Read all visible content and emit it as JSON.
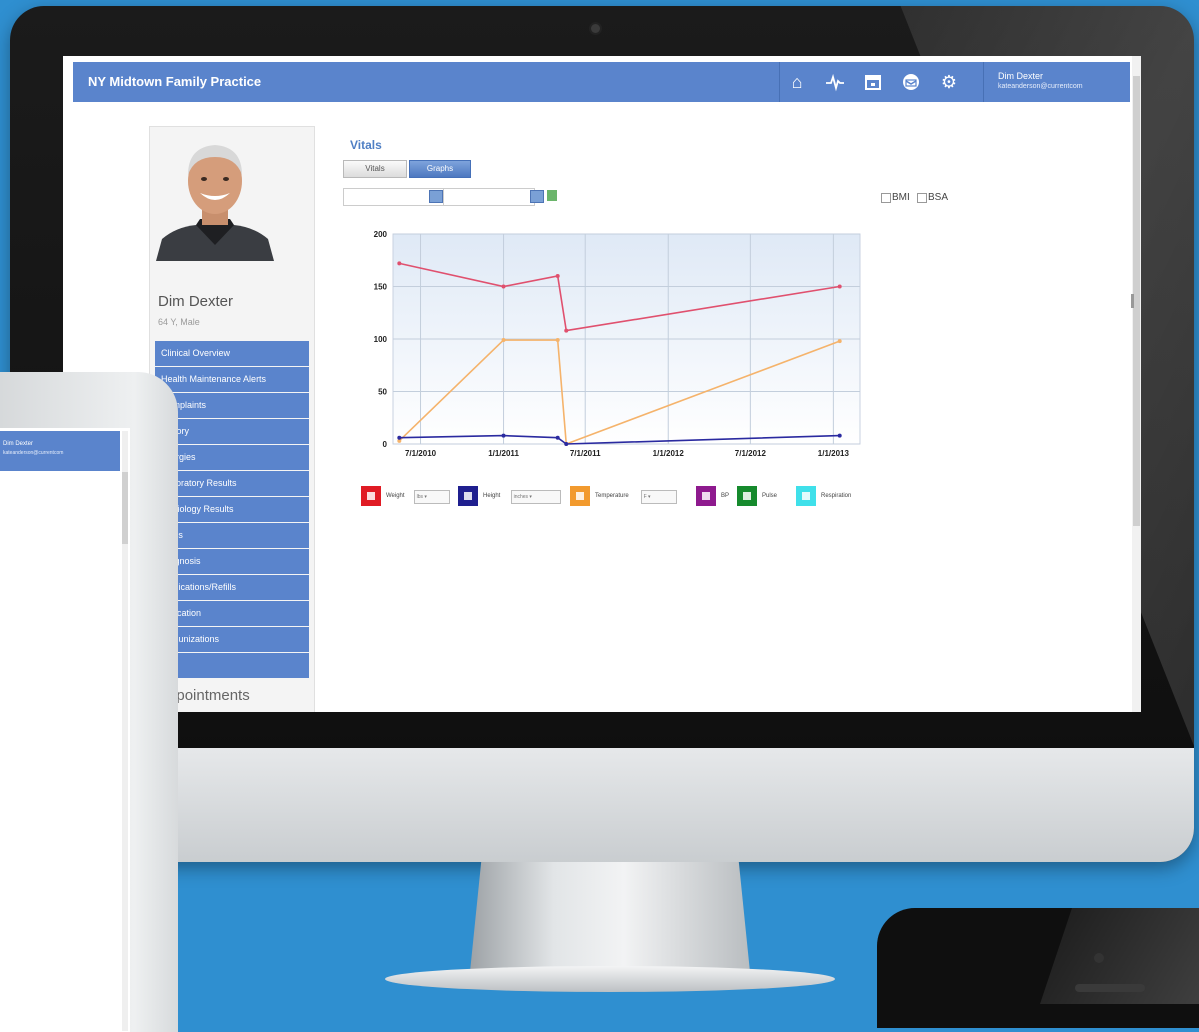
{
  "app": {
    "title": "NY Midtown Family Practice"
  },
  "header": {
    "icons": [
      "home-icon",
      "pulse-icon",
      "calendar-icon",
      "mail-icon",
      "gear-icon"
    ],
    "user_name": "Dim Dexter",
    "user_email": "kateanderson@currentcom"
  },
  "patient": {
    "name": "Dim Dexter",
    "info": "64 Y, Male",
    "menu": [
      "Clinical Overview",
      "Health Maintenance Alerts",
      "Complaints",
      "History",
      "Allergies",
      "Laboratory Results",
      "Radiology Results",
      "Vitals",
      "Diagnosis",
      "Medications/Refills",
      "Education",
      "Immunizations",
      ""
    ],
    "appointments_label": "Appointments"
  },
  "vitals": {
    "title": "Vitals",
    "tab_vitals": "Vitals",
    "tab_graphs": "Graphs",
    "bmi_label": "BMI",
    "bsa_label": "BSA"
  },
  "legend": [
    {
      "label": "Weight",
      "color": "#e01b24",
      "select": "lbs"
    },
    {
      "label": "Height",
      "color": "#1f1f8f",
      "select": "inches"
    },
    {
      "label": "Temperature",
      "color": "#f29a2e",
      "select": "F"
    },
    {
      "label": "BP",
      "color": "#8e1a8e",
      "select": ""
    },
    {
      "label": "Pulse",
      "color": "#168a2d",
      "select": ""
    },
    {
      "label": "Respiration",
      "color": "#3fe0ea",
      "select": ""
    }
  ],
  "chart_data": {
    "type": "line",
    "ylim": [
      0,
      200
    ],
    "yticks": [
      "0",
      "50",
      "100",
      "150",
      "200"
    ],
    "xticks": [
      "7/1/2010",
      "1/1/2011",
      "7/1/2011",
      "1/1/2012",
      "7/1/2012",
      "1/1/2013"
    ],
    "xlim": [
      "2010-05-01",
      "2013-03-01"
    ],
    "grid": true,
    "series": [
      {
        "name": "Weight",
        "color": "#e0506e",
        "x": [
          "2010-05-15",
          "2011-01-01",
          "2011-05-01",
          "2011-05-20",
          "2013-01-15"
        ],
        "values": [
          172,
          150,
          160,
          108,
          150
        ]
      },
      {
        "name": "Temperature",
        "color": "#f5b36b",
        "x": [
          "2010-05-15",
          "2011-01-01",
          "2011-05-01",
          "2011-05-20",
          "2013-01-15"
        ],
        "values": [
          3,
          99,
          99,
          0,
          98
        ]
      },
      {
        "name": "Height",
        "color": "#2a2aa0",
        "x": [
          "2010-05-15",
          "2011-01-01",
          "2011-05-01",
          "2011-05-20",
          "2013-01-15"
        ],
        "values": [
          6,
          8,
          6,
          0,
          8
        ]
      }
    ]
  },
  "tablet": {
    "user_name": "Dim Dexter",
    "user_email": "kateanderson@currentcom"
  }
}
